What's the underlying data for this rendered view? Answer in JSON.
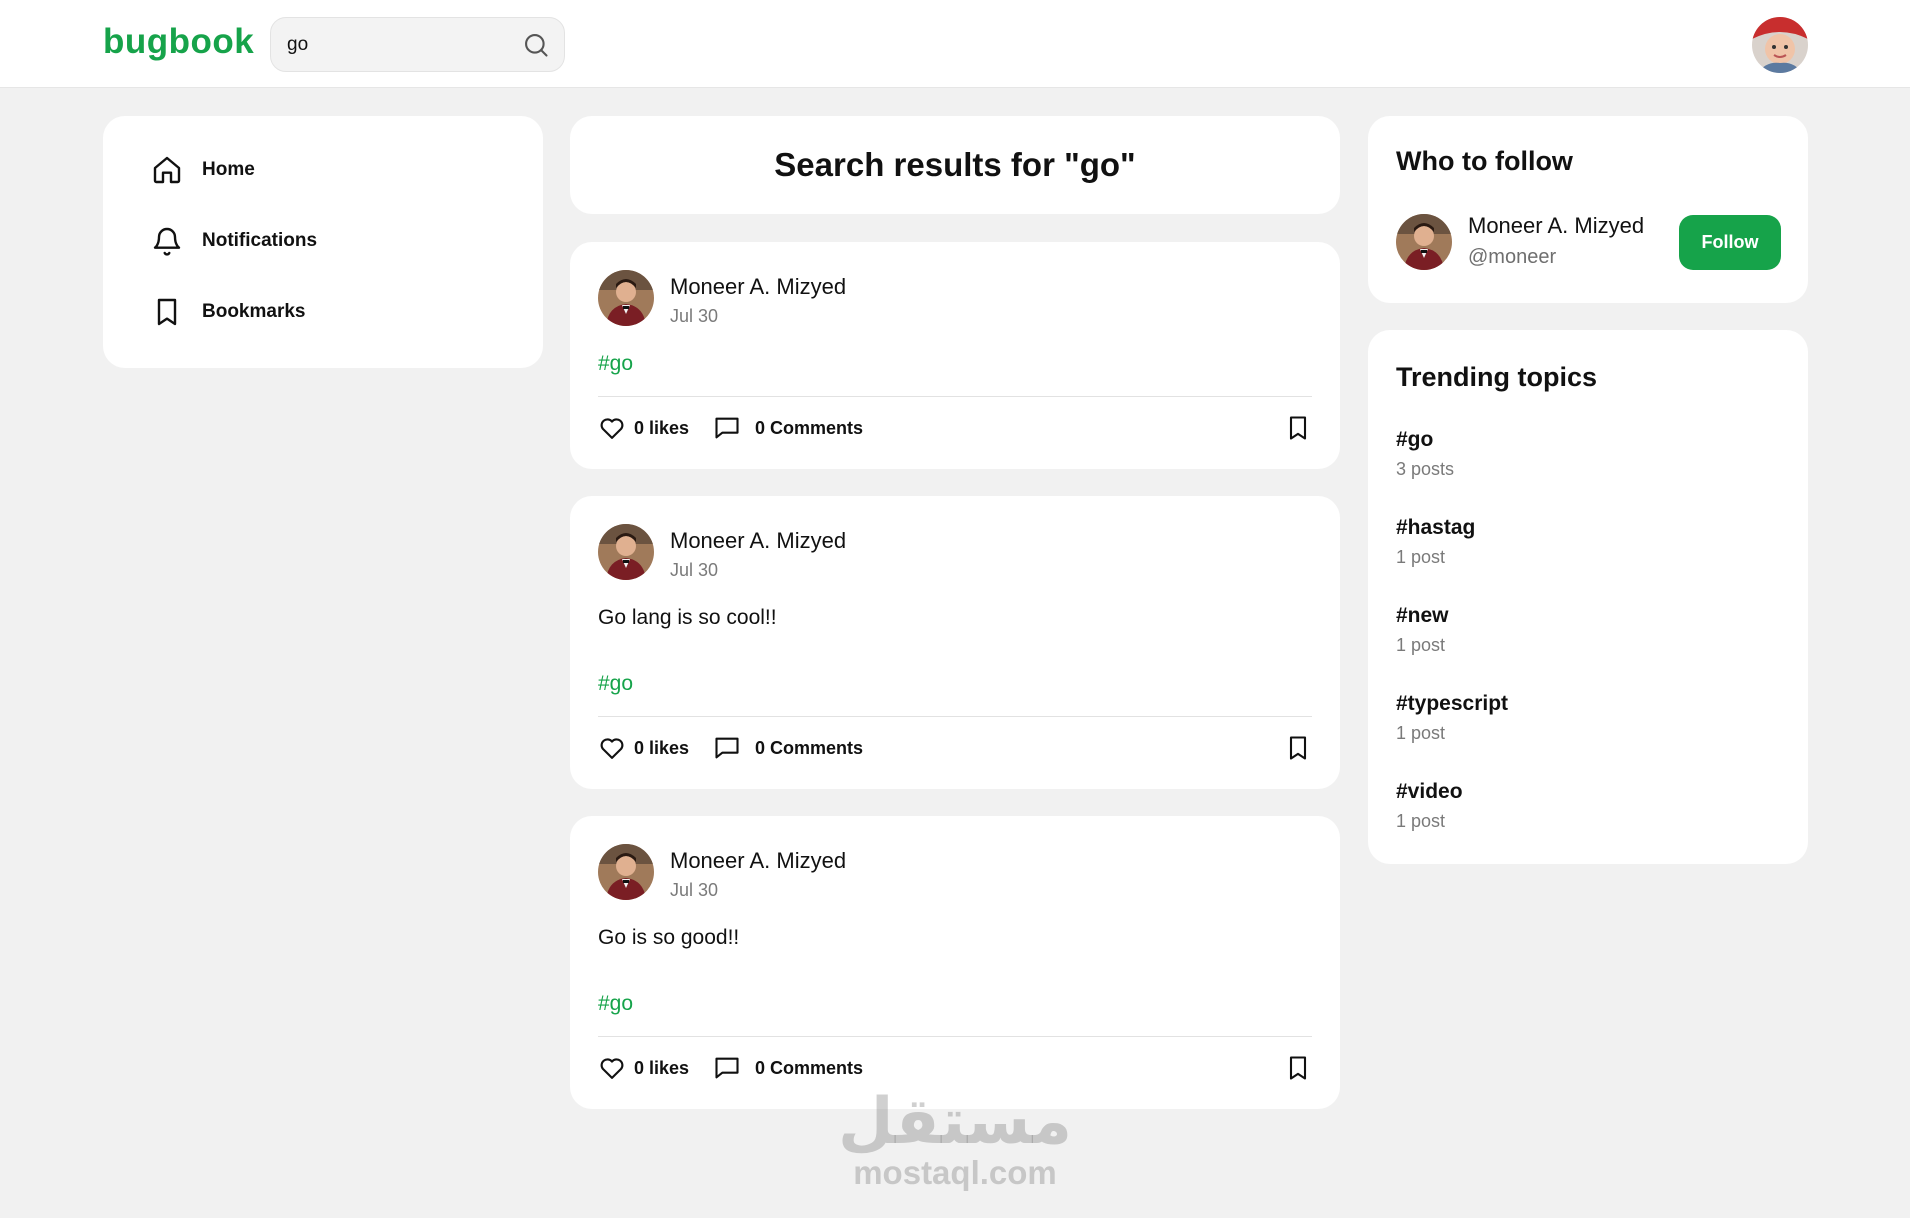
{
  "header": {
    "logo": "bugbook",
    "search": {
      "value": "go",
      "placeholder": "Search"
    }
  },
  "nav": {
    "items": [
      {
        "label": "Home",
        "icon": "home-icon"
      },
      {
        "label": "Notifications",
        "icon": "bell-icon"
      },
      {
        "label": "Bookmarks",
        "icon": "bookmark-icon"
      }
    ]
  },
  "main": {
    "title": "Search results for \"go\"",
    "posts": [
      {
        "author": "Moneer A. Mizyed",
        "date": "Jul 30",
        "text": "",
        "tag": "#go",
        "likes": "0 likes",
        "comments": "0 Comments"
      },
      {
        "author": "Moneer A. Mizyed",
        "date": "Jul 30",
        "text": "Go lang is so cool!!",
        "tag": "#go",
        "likes": "0 likes",
        "comments": "0 Comments"
      },
      {
        "author": "Moneer A. Mizyed",
        "date": "Jul 30",
        "text": "Go is so good!!",
        "tag": "#go",
        "likes": "0 likes",
        "comments": "0 Comments"
      }
    ]
  },
  "who_to_follow": {
    "title": "Who to follow",
    "user": {
      "name": "Moneer A. Mizyed",
      "handle": "@moneer"
    },
    "follow_label": "Follow"
  },
  "trending": {
    "title": "Trending topics",
    "topics": [
      {
        "name": "#go",
        "count": "3 posts"
      },
      {
        "name": "#hastag",
        "count": "1 post"
      },
      {
        "name": "#new",
        "count": "1 post"
      },
      {
        "name": "#typescript",
        "count": "1 post"
      },
      {
        "name": "#video",
        "count": "1 post"
      }
    ]
  },
  "watermark": {
    "arabic": "مستقل",
    "latin": "mostaql.com"
  },
  "colors": {
    "accent": "#16a34a",
    "background": "#f1f1f1"
  }
}
